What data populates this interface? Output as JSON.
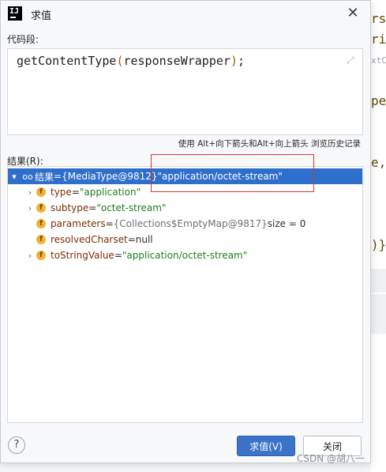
{
  "window": {
    "title": "求值",
    "app_icon_letters": "IJ"
  },
  "code_section": {
    "label": "代码段:",
    "expression_parts": [
      "getContentType",
      "(",
      "responseWrapper",
      ")",
      ";"
    ],
    "hint": "使用 Alt+向下箭头和Alt+向上箭头 浏览历史记录"
  },
  "result_section": {
    "label": "结果(R):",
    "root": {
      "name": "结果",
      "eq": " = ",
      "ref": "{MediaType@9812}",
      "value": " \"application/octet-stream\""
    },
    "fields": [
      {
        "name": "type",
        "eq": " = ",
        "value": "\"application\"",
        "kind": "str",
        "expandable": true
      },
      {
        "name": "subtype",
        "eq": " = ",
        "value": "\"octet-stream\"",
        "kind": "str",
        "expandable": true
      },
      {
        "name": "parameters",
        "eq": " = ",
        "value": "{Collections$EmptyMap@9817}",
        "extra": "  size = 0",
        "kind": "obj",
        "expandable": false
      },
      {
        "name": "resolvedCharset",
        "eq": " = ",
        "value": "null",
        "kind": "null",
        "expandable": false
      },
      {
        "name": "toStringValue",
        "eq": " = ",
        "value": "\"application/octet-stream\"",
        "kind": "str",
        "expandable": true
      }
    ]
  },
  "buttons": {
    "evaluate": "求值(V)",
    "close": "关闭",
    "help": "?"
  },
  "background": {
    "snippets": [
      "rs;",
      "rid",
      "xtC",
      "pe",
      "e,",
      ")}"
    ]
  },
  "watermark": "CSDN @胡八一"
}
